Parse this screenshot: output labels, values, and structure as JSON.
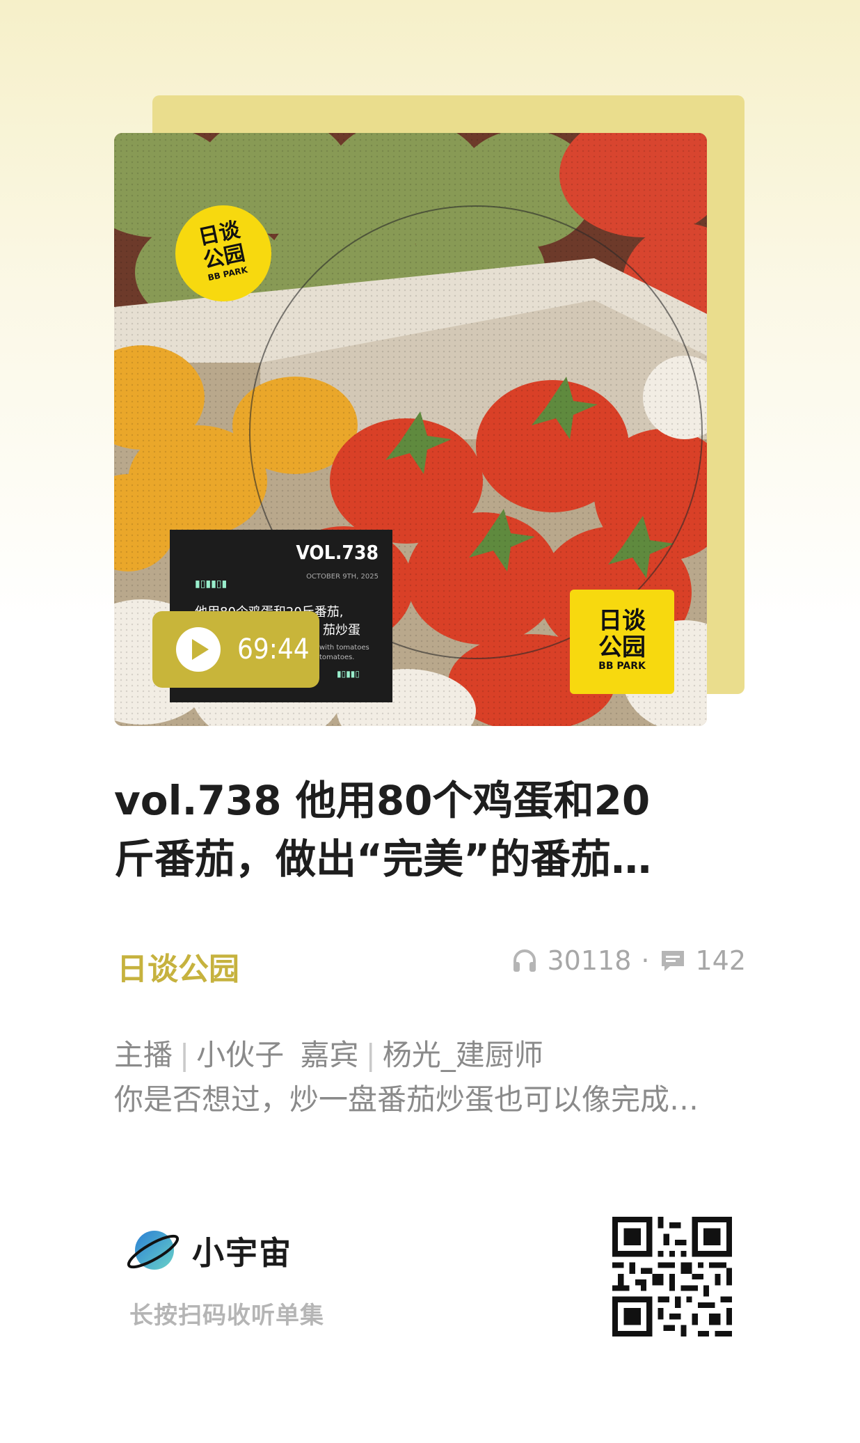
{
  "cover": {
    "badge_top": {
      "line1": "日谈",
      "line2": "公园",
      "sub": "BB PARK"
    },
    "badge_bottom": {
      "line1": "日谈",
      "line2": "公园",
      "sub": "BB PARK"
    },
    "episode_card": {
      "vol": "VOL.738",
      "date": "OCTOBER 9TH, 2025",
      "headline_line1": "他用80个鸡蛋和20斤番茄,",
      "headline_line2": "茄炒蛋",
      "english_line1": "with tomatoes",
      "english_line2": "tomatoes."
    }
  },
  "player": {
    "duration": "69:44"
  },
  "episode": {
    "title_line1": "vol.738 他用80个鸡蛋和20",
    "title_line2": "斤番茄，做出“完美”的番茄…",
    "channel": "日谈公园",
    "plays": "30118",
    "comments": "142",
    "stats_dot": "·",
    "host_label": "主播",
    "host_name": "小伙子",
    "guest_label": "嘉宾",
    "guest_name": "杨光_建厨师",
    "divider": "|",
    "description": "你是否想过，炒一盘番茄炒蛋也可以像完成…"
  },
  "footer": {
    "app_name": "小宇宙",
    "scan_hint": "长按扫码收听单集"
  },
  "colors": {
    "accent": "#c6b23e",
    "badge_yellow": "#f7d90f"
  }
}
